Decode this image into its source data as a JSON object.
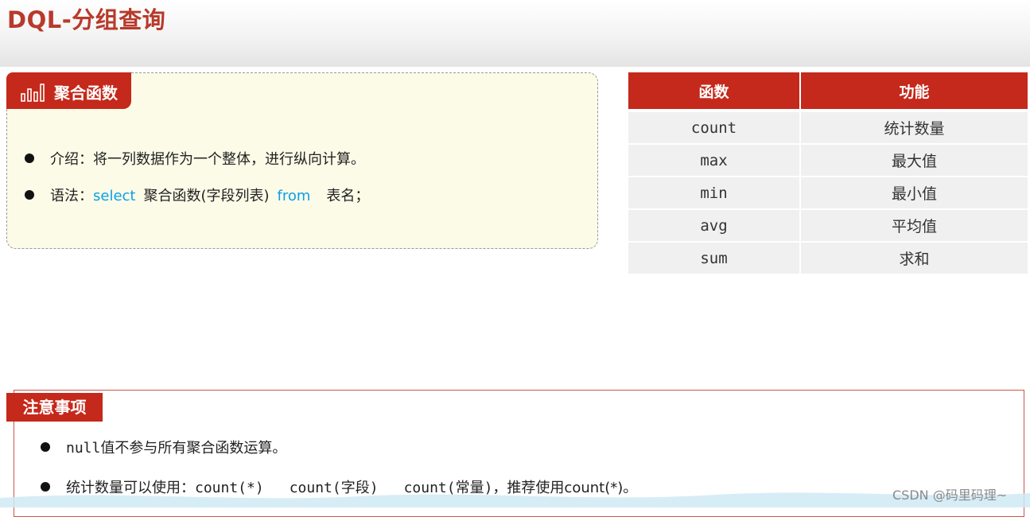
{
  "page": {
    "title": "DQL-分组查询"
  },
  "agg_card": {
    "tab_label": "聚合函数",
    "intro": {
      "label": "介绍：",
      "text": "将一列数据作为一个整体，进行纵向计算。"
    },
    "syntax": {
      "label": "语法：",
      "kw_select": "select",
      "func_part": "聚合函数(字段列表)",
      "kw_from": "from",
      "table_part": "表名；"
    }
  },
  "fn_table": {
    "headers": [
      "函数",
      "功能"
    ],
    "rows": [
      [
        "count",
        "统计数量"
      ],
      [
        "max",
        "最大值"
      ],
      [
        "min",
        "最小值"
      ],
      [
        "avg",
        "平均值"
      ],
      [
        "sum",
        "求和"
      ]
    ]
  },
  "notes": {
    "tab_label": "注意事项",
    "note1": {
      "mono": "null",
      "text": "值不参与所有聚合函数运算。"
    },
    "note2": {
      "prefix": "统计数量可以使用：",
      "opt1": "count(*)",
      "opt2": "count(字段)",
      "opt3": "count(常量)",
      "suffix": "，推荐使用count(*)。"
    }
  },
  "watermark": "CSDN @码里码理~",
  "colors": {
    "accent": "#c4291b",
    "keyword": "#0aa0e8",
    "card_bg": "#fcfbe8"
  }
}
